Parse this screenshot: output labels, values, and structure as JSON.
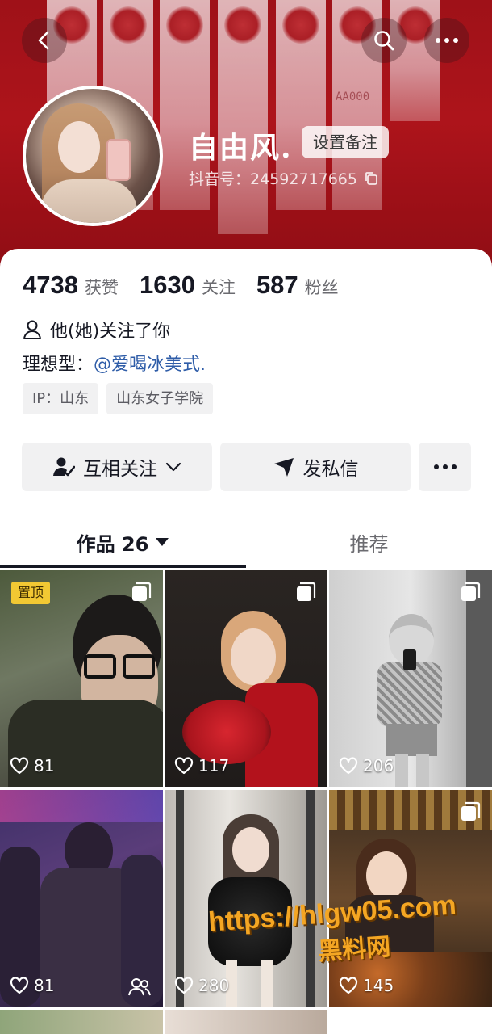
{
  "header": {
    "banknote_serial": "AA000",
    "nickname": "自由风.",
    "remark_button": "设置备注",
    "douyin_id": "抖音号：24592717665"
  },
  "stats": [
    {
      "value": "4738",
      "label": "获赞"
    },
    {
      "value": "1630",
      "label": "关注"
    },
    {
      "value": "587",
      "label": "粉丝"
    }
  ],
  "profile": {
    "follows_you": "他(她)关注了你",
    "bio_prefix": "理想型：",
    "bio_mention": "@爱喝冰美式.",
    "tags": [
      "IP：山东",
      "山东女子学院"
    ]
  },
  "actions": {
    "mutual_follow": "互相关注",
    "message": "发私信"
  },
  "tabs": {
    "works": "作品 26",
    "recommend": "推荐"
  },
  "videos": [
    {
      "likes": "81",
      "pinned": "置顶"
    },
    {
      "likes": "117"
    },
    {
      "likes": "206"
    },
    {
      "likes": "81"
    },
    {
      "likes": "280"
    },
    {
      "likes": "145"
    }
  ],
  "watermark": {
    "url": "https://hlgw05.com",
    "name": "黑料网"
  }
}
